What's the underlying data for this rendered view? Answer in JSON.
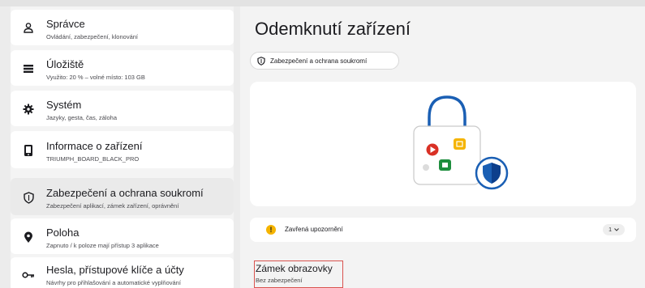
{
  "sidebar": {
    "items": [
      {
        "title": "Správce",
        "subtitle": "Ovládání, zabezpečení, klonování",
        "icon": "person-icon"
      },
      {
        "title": "Úložiště",
        "subtitle": "Využito: 20 % – volné místo: 103 GB",
        "icon": "storage-icon"
      },
      {
        "title": "Systém",
        "subtitle": "Jazyky, gesta, čas, záloha",
        "icon": "gear-icon"
      },
      {
        "title": "Informace o zařízení",
        "subtitle": "TRIUMPH_BOARD_BLACK_PRO",
        "icon": "device-icon"
      },
      {
        "title": "Zabezpečení a ochrana soukromí",
        "subtitle": "Zabezpečení aplikací, zámek zařízení, oprávnění",
        "icon": "shield-icon",
        "active": true
      },
      {
        "title": "Poloha",
        "subtitle": "Zapnuto / k poloze mají přístup 3 aplikace",
        "icon": "location-pin-icon"
      },
      {
        "title": "Hesla, přístupové klíče a účty",
        "subtitle": "Návrhy pro přihlašování a automatické vyplňování",
        "icon": "key-icon"
      }
    ]
  },
  "main": {
    "title": "Odemknutí zařízení",
    "breadcrumb_chip": "Zabezpečení a ochrana soukromí",
    "alert": {
      "label": "Zavřená upozornění",
      "count": "1"
    },
    "screen_lock": {
      "title": "Zámek obrazovky",
      "subtitle": "Bez zabezpečení"
    }
  },
  "colors": {
    "accent_blue": "#1a5fb4",
    "alert_yellow": "#f5b400",
    "highlight_red": "#d9534f"
  }
}
